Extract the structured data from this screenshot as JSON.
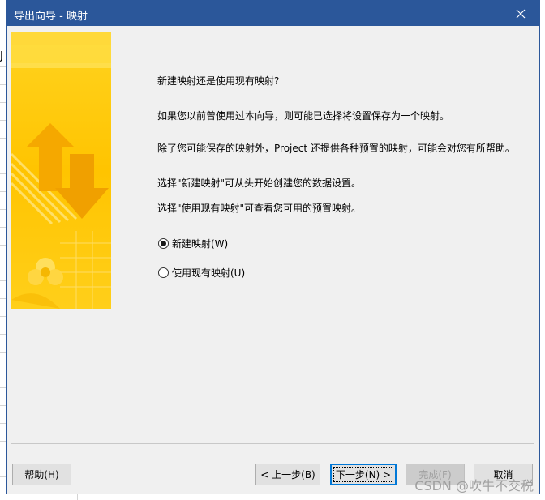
{
  "window": {
    "title": "导出向导 - 映射",
    "close_icon": "close-icon"
  },
  "background": {
    "cell_char": "J"
  },
  "sidebar_image": {
    "icon": "wizard-arrows-illustration"
  },
  "content": {
    "question": "新建映射还是使用现有映射?",
    "para1": "如果您以前曾使用过本向导，则可能已选择将设置保存为一个映射。",
    "para2": "除了您可能保存的映射外，Project 还提供各种预置的映射，可能会对您有所帮助。",
    "para3": "选择\"新建映射\"可从头开始创建您的数据设置。",
    "para4": "选择\"使用现有映射\"可查看您可用的预置映射。"
  },
  "options": [
    {
      "label": "新建映射(W)",
      "checked": true
    },
    {
      "label": "使用现有映射(U)",
      "checked": false
    }
  ],
  "buttons": {
    "help": "帮助(H)",
    "back": "< 上一步(B)",
    "next": "下一步(N) >",
    "finish": "完成(F)",
    "cancel": "取消"
  },
  "watermark": "CSDN @吹牛不交税",
  "colors": {
    "titlebar": "#2b579a",
    "dialog_bg": "#f0f0f0",
    "accent_yellow": "#ffd21f"
  }
}
